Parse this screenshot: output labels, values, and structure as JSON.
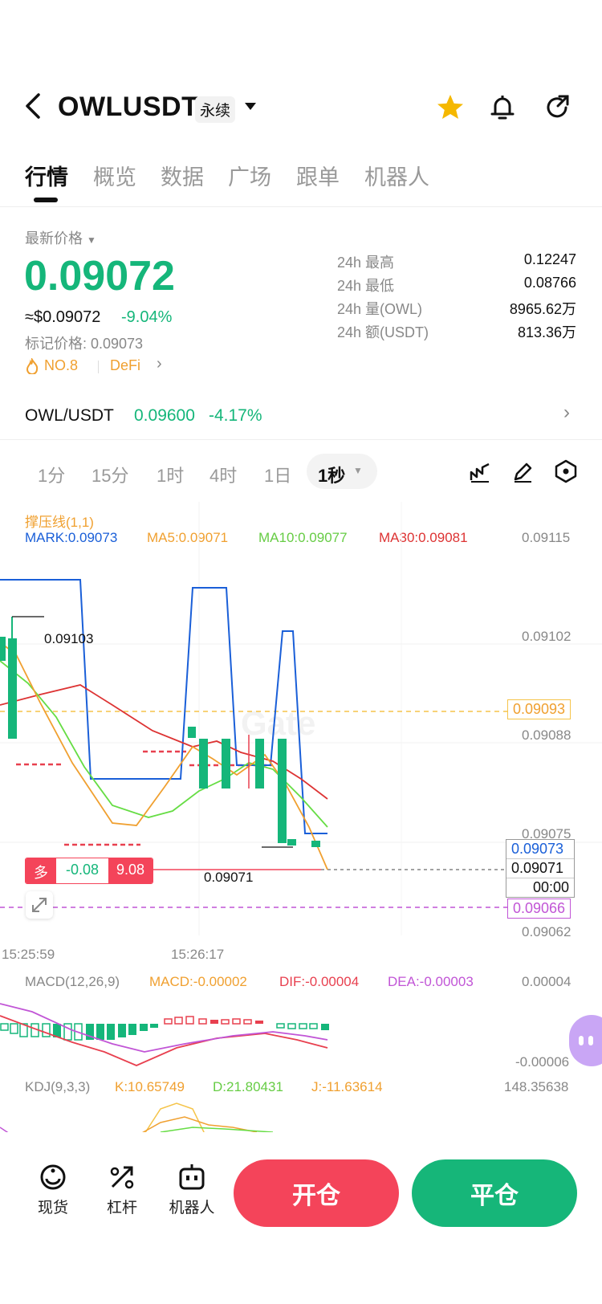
{
  "header": {
    "symbol": "OWLUSDT",
    "contract_type": "永续",
    "icons": [
      "back-icon",
      "chevron-down-icon",
      "star-icon",
      "bell-icon",
      "share-icon"
    ]
  },
  "tabs": [
    "行情",
    "概览",
    "数据",
    "广场",
    "跟单",
    "机器人"
  ],
  "price": {
    "latest_label": "最新价格",
    "last": "0.09072",
    "usd": "≈$0.09072",
    "change": "-9.04%",
    "mark": "标记价格: 0.09073",
    "rank": "NO.8",
    "sector": "DeFi"
  },
  "stats": [
    {
      "label": "24h  最高",
      "value": "0.12247"
    },
    {
      "label": "24h  最低",
      "value": "0.08766"
    },
    {
      "label": "24h  量(OWL)",
      "value": "8965.62万"
    },
    {
      "label": "24h  额(USDT)",
      "value": "813.36万"
    }
  ],
  "spot": {
    "pair": "OWL/USDT",
    "price": "0.09600",
    "change": "-4.17%"
  },
  "timeframes": [
    "1分",
    "15分",
    "1时",
    "4时",
    "1日",
    "1秒"
  ],
  "indicators": {
    "support": "撑压线(1,1)",
    "mark": "MARK:0.09073",
    "ma5": "MA5:0.09071",
    "ma10": "MA10:0.09077",
    "ma30": "MA30:0.09081"
  },
  "chart": {
    "y_ticks": [
      "0.09115",
      "0.09102",
      "0.09088",
      "0.09075",
      "0.09062"
    ],
    "x_ticks": [
      "15:25:59",
      "15:26:17"
    ],
    "annot_high": "0.09103",
    "annot_low": "0.09071",
    "alert_price": "0.09093",
    "mark_box": "0.09073",
    "last_box": "0.09071",
    "countdown": "00:00",
    "lower_price": "0.09066",
    "position": {
      "side": "多",
      "pnl": "-0.08",
      "size": "9.08"
    },
    "watermark": "Gate"
  },
  "macd": {
    "label": "MACD(12,26,9)",
    "macd": "MACD:-0.00002",
    "dif": "DIF:-0.00004",
    "dea": "DEA:-0.00003",
    "top": "0.00004",
    "bottom": "-0.00006"
  },
  "kdj": {
    "label": "KDJ(9,3,3)",
    "k": "K:10.65749",
    "d": "D:21.80431",
    "j": "J:-11.63614",
    "top": "148.35638"
  },
  "bottom_nav": [
    {
      "label": "现货",
      "icon": "spot-icon"
    },
    {
      "label": "杠杆",
      "icon": "leverage-icon"
    },
    {
      "label": "机器人",
      "icon": "robot-icon"
    }
  ],
  "actions": {
    "open": "开仓",
    "close": "平仓"
  },
  "colors": {
    "green": "#15b67a",
    "red": "#f4445a",
    "blue": "#1a5fd8",
    "orange": "#f0a030",
    "ma10": "#66dd44",
    "ma30": "#dd3333"
  }
}
